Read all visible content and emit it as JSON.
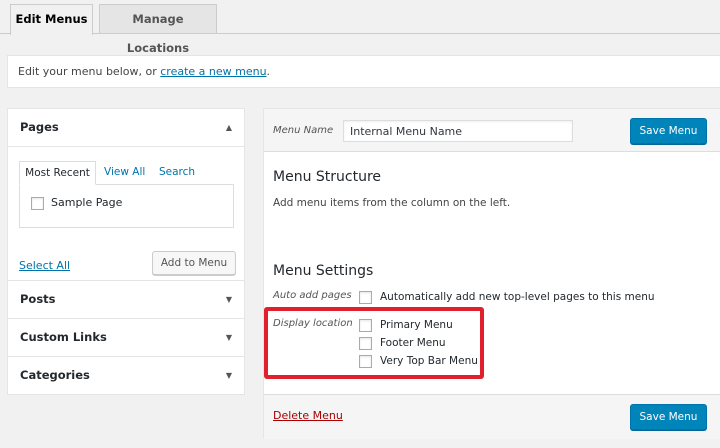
{
  "tabs": [
    {
      "label": "Edit Menus",
      "active": true
    },
    {
      "label": "Manage Locations",
      "active": false
    }
  ],
  "notice": {
    "text": "Edit your menu below, or ",
    "link": "create a new menu",
    "suffix": "."
  },
  "left": {
    "pages": {
      "title": "Pages",
      "tabs": [
        "Most Recent",
        "View All",
        "Search"
      ],
      "items": [
        {
          "label": "Sample Page",
          "checked": false
        }
      ],
      "select_all": "Select All",
      "add_button": "Add to Menu"
    },
    "sections": [
      "Posts",
      "Custom Links",
      "Categories"
    ]
  },
  "menu": {
    "name_label": "Menu Name",
    "name_value": "Internal Menu Name",
    "save_label": "Save Menu",
    "structure_title": "Menu Structure",
    "structure_text": "Add menu items from the column on the left.",
    "settings_title": "Menu Settings",
    "auto_add_label": "Auto add pages",
    "auto_add_text": "Automatically add new top-level pages to this menu",
    "display_location_label": "Display location",
    "locations": [
      {
        "label": "Primary Menu",
        "checked": false
      },
      {
        "label": "Footer Menu",
        "checked": false
      },
      {
        "label": "Very Top Bar Menu",
        "checked": false
      }
    ],
    "delete_label": "Delete Menu"
  },
  "colors": {
    "primary": "#0085ba",
    "link": "#0073aa",
    "delete": "#a00",
    "highlight": "#e0202d"
  }
}
